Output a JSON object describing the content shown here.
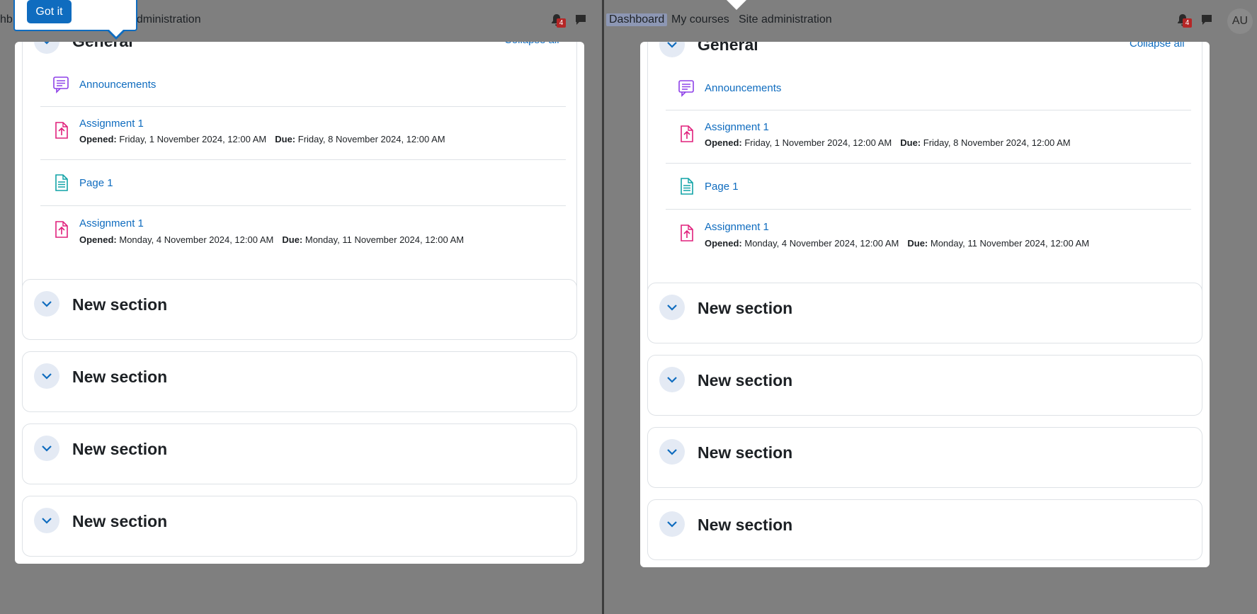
{
  "nav": {
    "dashboard": "Dashboard",
    "my_courses": "My courses",
    "site_admin": "Site administration",
    "left_dashboard_fragment": "hb",
    "left_admin_fragment": "administration",
    "notification_count": "4",
    "avatar_initials": "AU"
  },
  "tour": {
    "got_it": "Got it"
  },
  "course": {
    "general_title": "General",
    "collapse_all": "Collapse all",
    "activities": [
      {
        "type": "forum",
        "name": "Announcements"
      },
      {
        "type": "assignment",
        "name": "Assignment 1",
        "opened_label": "Opened:",
        "opened": "Friday, 1 November 2024, 12:00 AM",
        "due_label": "Due:",
        "due": "Friday, 8 November 2024, 12:00 AM"
      },
      {
        "type": "page",
        "name": "Page 1"
      },
      {
        "type": "assignment",
        "name": "Assignment 1",
        "opened_label": "Opened:",
        "opened": "Monday, 4 November 2024, 12:00 AM",
        "due_label": "Due:",
        "due": "Monday, 11 November 2024, 12:00 AM"
      }
    ],
    "sections": [
      {
        "title": "New section"
      },
      {
        "title": "New section"
      },
      {
        "title": "New section"
      },
      {
        "title": "New section"
      }
    ]
  },
  "colors": {
    "accent": "#0f6cbf",
    "forum": "#8e40e8",
    "assignment": "#e0207c",
    "page": "#11a3a7"
  }
}
